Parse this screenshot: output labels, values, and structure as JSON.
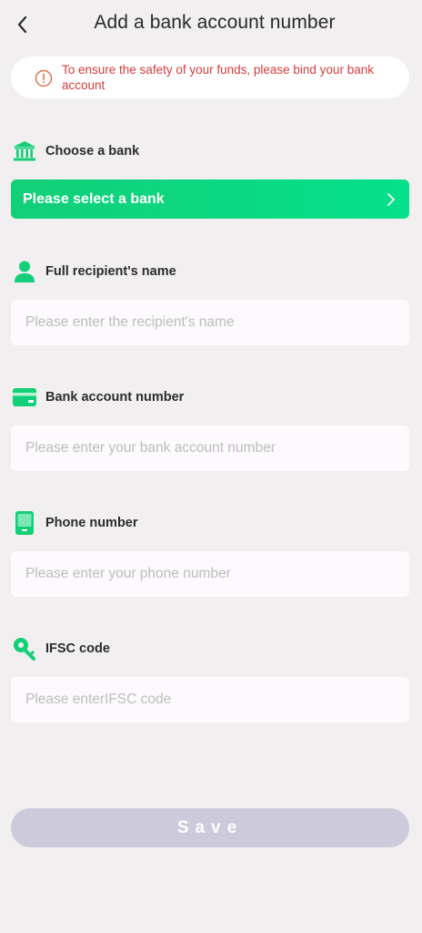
{
  "header": {
    "title": "Add a bank account number",
    "back_icon": "chevron-left-icon"
  },
  "notice": {
    "icon": "alert-circle-icon",
    "text": "To ensure the safety of your funds, please bind your bank account",
    "color": "#d63c3c"
  },
  "bank": {
    "label": "Choose a bank",
    "icon": "bank-icon",
    "select_text": "Please select a bank",
    "arrow_icon": "chevron-right-icon"
  },
  "recipient": {
    "label": "Full recipient's name",
    "icon": "user-icon",
    "placeholder": "Please enter the recipient's name",
    "value": ""
  },
  "account": {
    "label": "Bank account number",
    "icon": "card-icon",
    "placeholder": "Please enter your bank account number",
    "value": ""
  },
  "phone": {
    "label": "Phone number",
    "icon": "phone-icon",
    "placeholder": "Please enter your phone number",
    "value": ""
  },
  "ifsc": {
    "label": "IFSC code",
    "icon": "key-icon",
    "placeholder": "Please enterIFSC code",
    "value": ""
  },
  "save": {
    "label": "Save"
  },
  "colors": {
    "accent": "#12cf78",
    "background": "#f1efef",
    "save_disabled": "#cdcbdb"
  }
}
